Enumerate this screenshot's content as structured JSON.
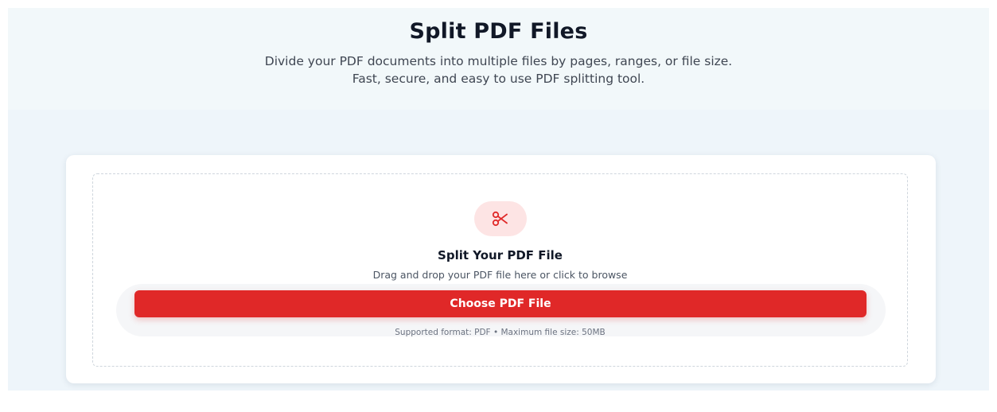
{
  "hero": {
    "title": "Split PDF Files",
    "subtitle_line1": "Divide your PDF documents into multiple files by pages, ranges, or file size.",
    "subtitle_line2": "Fast, secure, and easy to use PDF splitting tool."
  },
  "upload": {
    "icon": "scissors-icon",
    "title": "Split Your PDF File",
    "hint": "Drag and drop your PDF file here or click to browse",
    "button_label": "Choose PDF File",
    "note": "Supported format: PDF • Maximum file size: 50MB"
  },
  "colors": {
    "accent": "#e02828",
    "icon_bg": "#fde4e4",
    "hero_bg": "#f2f8fa",
    "workspace_bg": "#eef5fa"
  }
}
